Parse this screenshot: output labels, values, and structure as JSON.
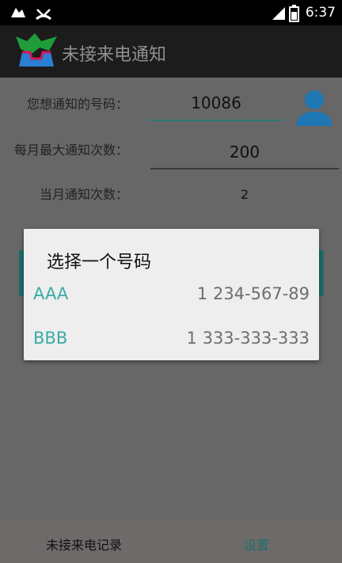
{
  "status_bar": {
    "time": "6:37",
    "left_icons": [
      "notification-icon",
      "missed-call-icon"
    ],
    "right_icons": [
      "signal-icon",
      "battery-icon"
    ]
  },
  "app_bar": {
    "title": "未接来电通知",
    "logo_icon": "app-logo-icon"
  },
  "form": {
    "number_label": "您想通知的号码：",
    "number_value": "10086",
    "max_label": "每月最大通知次数：",
    "max_value": "200",
    "month_count_label": "当月通知次数：",
    "month_count_value": "2",
    "contact_icon": "contact-person-icon"
  },
  "dialog": {
    "title": "选择一个号码",
    "items": [
      {
        "name": "AAA",
        "number": "1 234-567-89"
      },
      {
        "name": "BBB",
        "number": "1 333-333-333"
      }
    ]
  },
  "bottom_nav": {
    "tabs": [
      {
        "label": "未接来电记录",
        "color": "#111111"
      },
      {
        "label": "设置",
        "color": "#1e6e6a"
      }
    ]
  },
  "colors": {
    "accent": "#3aaaa6",
    "dim_background": "#676767",
    "dialog_bg": "#eeeeee"
  }
}
